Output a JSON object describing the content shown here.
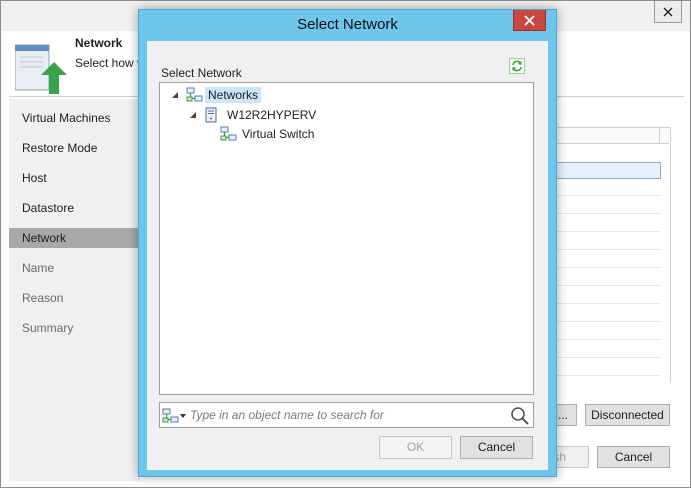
{
  "wizard": {
    "header_title": "Network",
    "header_subtitle": "Select how vi",
    "nav": [
      {
        "label": "Virtual Machines",
        "state": "normal"
      },
      {
        "label": "Restore Mode",
        "state": "normal"
      },
      {
        "label": "Host",
        "state": "normal"
      },
      {
        "label": "Datastore",
        "state": "normal"
      },
      {
        "label": "Network",
        "state": "active"
      },
      {
        "label": "Name",
        "state": "disabled"
      },
      {
        "label": "Reason",
        "state": "disabled"
      },
      {
        "label": "Summary",
        "state": "disabled"
      }
    ],
    "ellipsis_button": "...",
    "disconnected_button": "Disconnected",
    "finish_button": "sh",
    "cancel_button": "Cancel"
  },
  "dialog": {
    "title": "Select Network",
    "section_label": "Select Network",
    "tree": [
      {
        "label": "Networks",
        "selected": true,
        "icon": "network-icon"
      },
      {
        "label": "W12R2HYPERV",
        "selected": false,
        "icon": "server-icon"
      },
      {
        "label": "Virtual Switch",
        "selected": false,
        "icon": "virtual-switch-icon"
      }
    ],
    "search_placeholder": "Type in an object name to search for",
    "ok_button": "OK",
    "cancel_button": "Cancel"
  },
  "colors": {
    "dialog_frame": "#6ec6ec",
    "close_button": "#c7483f",
    "tree_selection": "#cce4f7",
    "nav_active": "#a8a8a8"
  }
}
